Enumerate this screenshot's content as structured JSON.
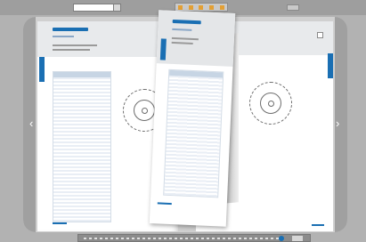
{
  "toolbar": {
    "search_placeholder": "",
    "icons": [
      "search-icon"
    ]
  },
  "viewer": {
    "colors": {
      "accent": "#1a6fb3",
      "background": "#b2b2b2"
    },
    "nav": {
      "prev_icon": "chevron-left-icon",
      "next_icon": "chevron-right-icon"
    }
  },
  "bottombar": {
    "zoom_control": "zoom-slider"
  }
}
